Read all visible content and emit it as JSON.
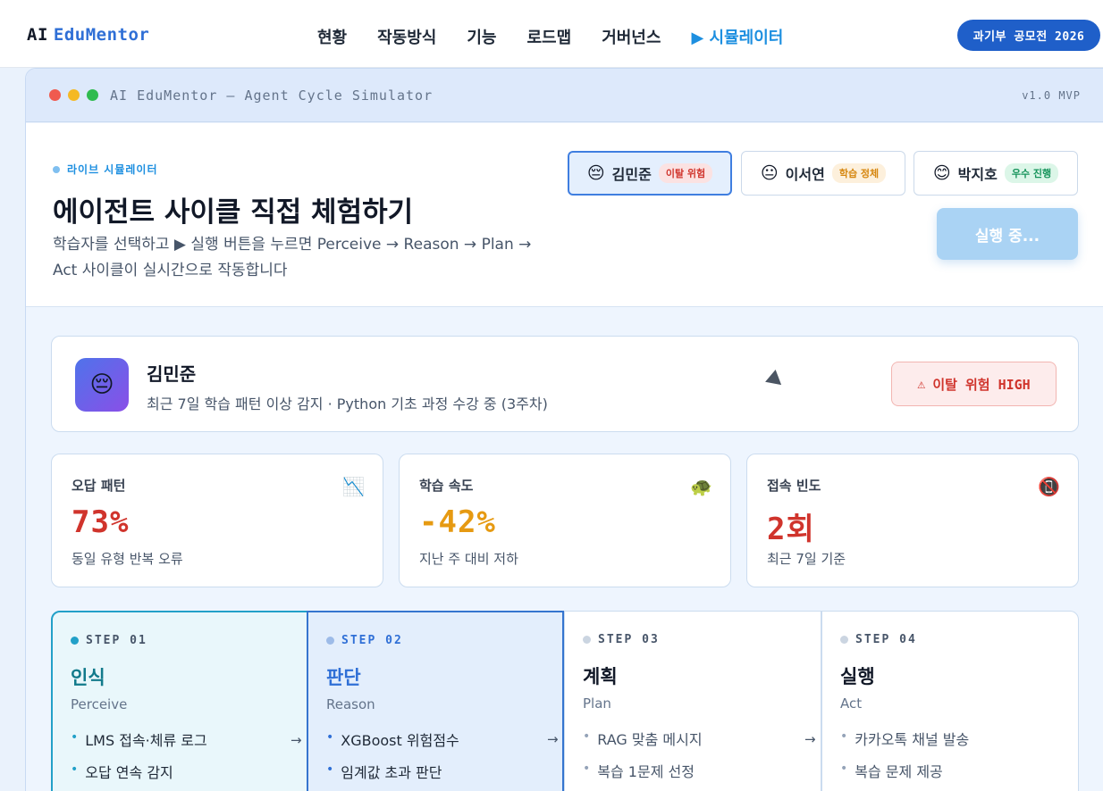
{
  "nav": {
    "brand_ai": "AI",
    "brand_name": "EduMentor",
    "links": [
      "현황",
      "작동방식",
      "기능",
      "로드맵",
      "거버넌스",
      "▶ 시뮬레이터"
    ],
    "cta": "과기부 공모전 2026"
  },
  "window": {
    "title": "AI EduMentor — Agent Cycle Simulator",
    "version": "v1.0 MVP"
  },
  "hero": {
    "live_label": "라이브 시뮬레이터",
    "title": "에이전트 사이클 직접 체험하기",
    "desc": "학습자를 선택하고 ▶ 실행 버튼을 누르면 Perceive → Reason → Plan → Act 사이클이 실시간으로 작동합니다",
    "learners": [
      {
        "emoji": "😔",
        "name": "김민준",
        "tag": "이탈 위험"
      },
      {
        "emoji": "😐",
        "name": "이서연",
        "tag": "학습 정체"
      },
      {
        "emoji": "😊",
        "name": "박지호",
        "tag": "우수 진행"
      }
    ],
    "run_label": "실행 중..."
  },
  "profile": {
    "emoji": "😔",
    "name": "김민준",
    "desc": "최근 7일 학습 패턴 이상 감지 · Python 기초 과정 수강 중 (3주차)",
    "risk_icon": "⚠",
    "risk_label": "이탈 위험 HIGH"
  },
  "metrics": [
    {
      "label": "오답 패턴",
      "icon": "📉",
      "value": "73%",
      "sub": "동일 유형 반복 오류",
      "color": "#d0342c"
    },
    {
      "label": "학습 속도",
      "icon": "🐢",
      "value": "-42%",
      "sub": "지난 주 대비 저하",
      "color": "#e69a12"
    },
    {
      "label": "접속 빈도",
      "icon": "📵",
      "value": "2회",
      "sub": "최근 7일 기준",
      "color": "#d0342c"
    }
  ],
  "steps": [
    {
      "label": "STEP 01",
      "title": "인식",
      "sub": "Perceive",
      "items": [
        "LMS 접속·체류 로그",
        "오답 연속 감지"
      ],
      "color": "#117a8b",
      "dot": "#22a0c8"
    },
    {
      "label": "STEP 02",
      "title": "판단",
      "sub": "Reason",
      "items": [
        "XGBoost 위험점수",
        "임계값 초과 판단"
      ],
      "color": "#2f6fd6",
      "dot": "#9dbbe8"
    },
    {
      "label": "STEP 03",
      "title": "계획",
      "sub": "Plan",
      "items": [
        "RAG 맞춤 메시지",
        "복습 1문제 선정"
      ],
      "color": "#111827",
      "dot": "#cbd5e1"
    },
    {
      "label": "STEP 04",
      "title": "실행",
      "sub": "Act",
      "items": [
        "카카오톡 채널 발송",
        "복습 문제 제공"
      ],
      "color": "#111827",
      "dot": "#cbd5e1"
    }
  ],
  "step_arrow": "→"
}
